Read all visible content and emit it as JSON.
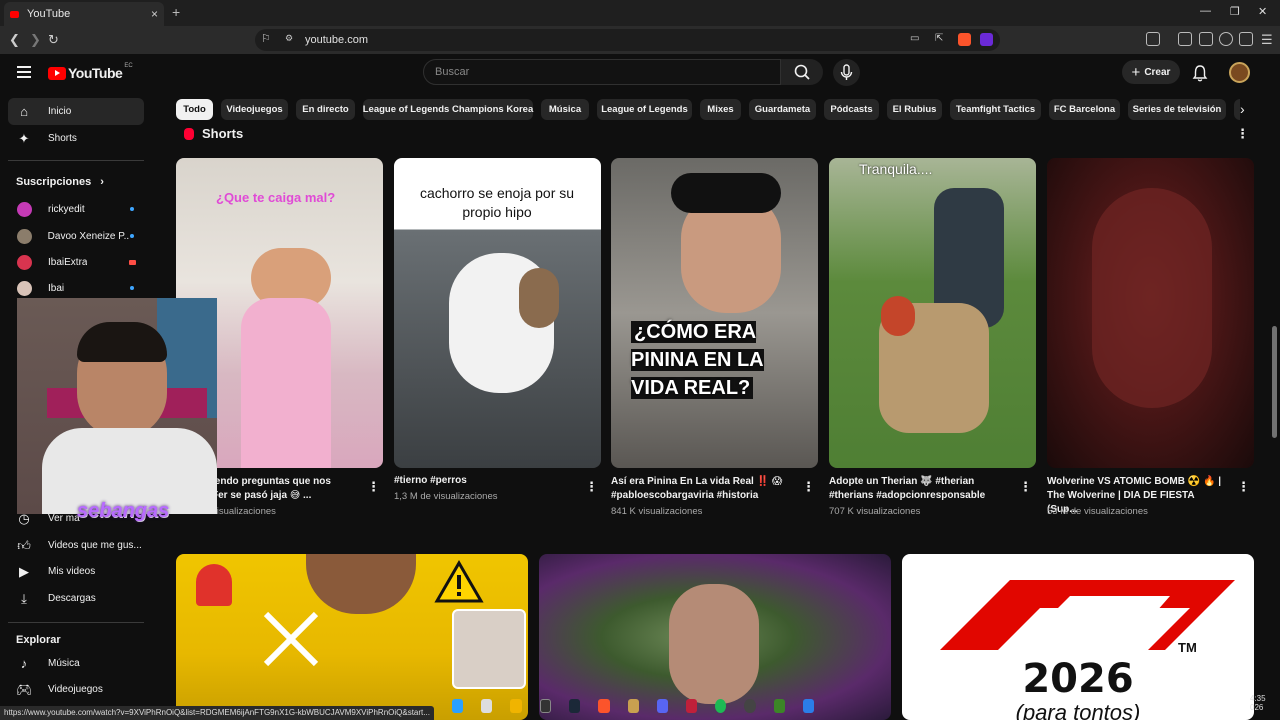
{
  "browser": {
    "tab_title": "YouTube",
    "tab_close": "×",
    "new_tab": "+",
    "url": "youtube.com",
    "status_url": "https://www.youtube.com/watch?v=9XViPhRnOiQ&list=RDGMEM6ijAnFTG9nX1G-kbWBUCJAVM9XViPhRnOiQ&start..."
  },
  "header": {
    "logo_text": "YouTube",
    "country_code": "EC",
    "search_placeholder": "Buscar",
    "create_label": "Crear"
  },
  "sidebar": {
    "main": [
      {
        "label": "Inicio",
        "icon": "home-icon"
      },
      {
        "label": "Shorts",
        "icon": "shorts-icon"
      }
    ],
    "subscriptions_heading": "Suscripciones",
    "subscriptions": [
      {
        "name": "rickyedit",
        "indicator": "new"
      },
      {
        "name": "Davoo Xeneize P...",
        "indicator": "new"
      },
      {
        "name": "IbaiExtra",
        "indicator": "live"
      },
      {
        "name": "Ibai",
        "indicator": "new"
      }
    ],
    "you_items": [
      {
        "label": "Ver ma",
        "icon": "history-icon"
      },
      {
        "label": "Videos que me gus...",
        "icon": "like-icon"
      },
      {
        "label": "Mis videos",
        "icon": "my-videos-icon"
      },
      {
        "label": "Descargas",
        "icon": "download-icon"
      }
    ],
    "explore_heading": "Explorar",
    "explore": [
      {
        "label": "Música",
        "icon": "music-icon"
      },
      {
        "label": "Videojuegos",
        "icon": "gaming-icon"
      }
    ]
  },
  "chips": [
    "Todo",
    "Videojuegos",
    "En directo",
    "League of Legends Champions Korea",
    "Música",
    "League of Legends",
    "Mixes",
    "Guardameta",
    "Pódcasts",
    "El Rubius",
    "Teamfight Tactics",
    "FC Barcelona",
    "Series de televisión"
  ],
  "shorts": {
    "heading": "Shorts",
    "items": [
      {
        "title": "iendo preguntas que nos",
        "title2": "Fer se pasó jaja 😅 ...",
        "views": "visualizaciones",
        "overlay": "¿Que te caiga mal?"
      },
      {
        "title": "#tierno #perros",
        "title2": "",
        "views": "1,3 M de visualizaciones",
        "overlay": "cachorro se enoja por su propio hipo"
      },
      {
        "title": "Así era Pinina En La vida Real ‼️ 😱",
        "title2": "#pabloescobargaviria #historia",
        "views": "841 K visualizaciones",
        "overlay": "¿CÓMO ERA PININA EN LA VIDA REAL?"
      },
      {
        "title": "Adopte un Therian 🐺 #therian",
        "title2": "#therians #adopcionresponsable",
        "views": "707 K visualizaciones",
        "overlay": "Tranquila...."
      },
      {
        "title": "Wolverine VS ATOMIC BOMB ☢️ 🔥 |",
        "title2": "The Wolverine | DIA DE FIESTA (Sup...",
        "views": "53 M de visualizaciones",
        "overlay": ""
      }
    ]
  },
  "videos": [
    {
      "overlay": ""
    },
    {
      "overlay": ""
    },
    {
      "overlay": "2026",
      "overlay2": "(para tontos)",
      "tm": "TM"
    }
  ],
  "webcam": {
    "name": "sebangas"
  },
  "clock": {
    "time": "4:35",
    "date": "026"
  },
  "colors": {
    "brand": "#ff0000",
    "chip_selected": "#f1f1f1",
    "background": "#0f0f0f"
  }
}
